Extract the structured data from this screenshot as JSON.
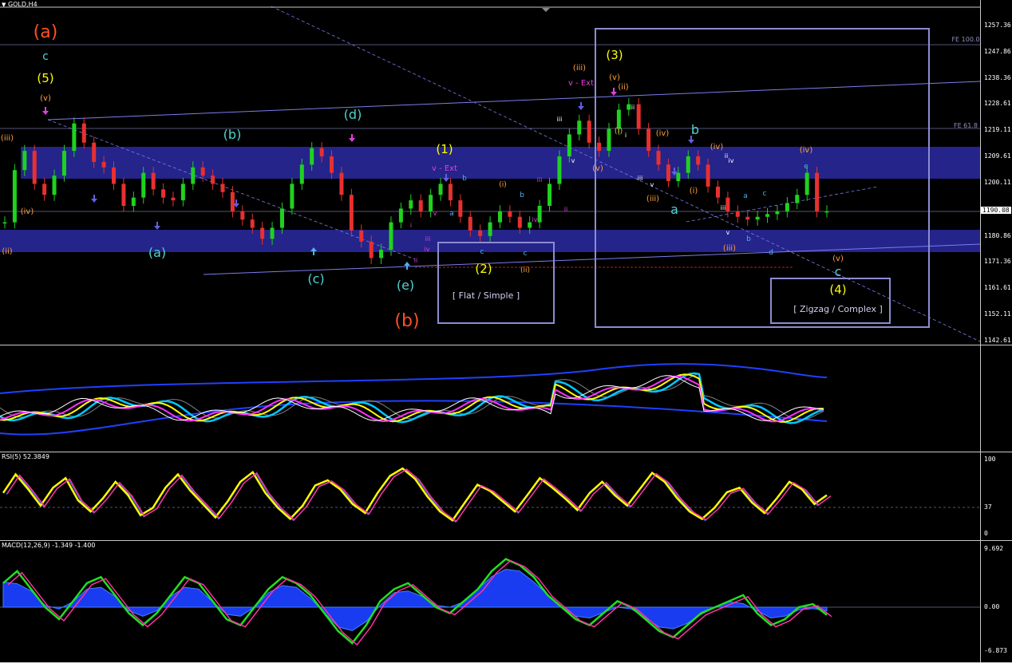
{
  "colors": {
    "bull": "#1fd21f",
    "bear": "#e83030",
    "band": "#24248a",
    "box": "#8c8cd2",
    "yellow": "#ffff00",
    "cyan": "#4fd2d2",
    "orange": "#ffa040",
    "magenta": "#e040e0"
  },
  "symbol": "GOLD,H4",
  "panes": {
    "main": {
      "ticks": [
        "1257.36",
        "1247.86",
        "1238.36",
        "1228.61",
        "1219.11",
        "1209.61",
        "1200.11",
        "1190.08",
        "1180.86",
        "1171.36",
        "1161.61",
        "1152.11",
        "1142.61"
      ],
      "current": "1190.08"
    },
    "rsi": {
      "title": "RSI(5) 52.3849",
      "ticks": [
        "100",
        "37",
        "0"
      ]
    },
    "macd": {
      "title": "MACD(12,26,9) -1.349 -1.400",
      "ticks": [
        "9.692",
        "0.00",
        "-6.873"
      ]
    }
  },
  "fib_levels": [
    "FE 100.0",
    "FE 61.8"
  ],
  "wave_labels": [
    "(a)",
    "c",
    "(5)",
    "(v)",
    "(iii)",
    "(iv)",
    "(ii)",
    "(b)",
    "(a)",
    "(c)",
    "(d)",
    "(e)",
    "(b)",
    "i",
    "ii",
    "iii",
    "iv",
    "v",
    "(1)",
    "v - Ext",
    "b",
    "a",
    "c",
    "b",
    "(i)",
    "(2)",
    "(ii)",
    "c",
    "iii",
    "iv",
    "ii",
    "(iii)",
    "v - Ext",
    "v",
    "iii",
    "(3)",
    "(v)",
    "(ii)",
    "(i)",
    "i",
    "ii",
    "(iv)",
    "iii",
    "(iii)",
    "(v)",
    "v",
    "b",
    "(iv)",
    "(i)",
    "ii",
    "a",
    "iv",
    "iii",
    "a",
    "c",
    "v",
    "b",
    "(iii)",
    "d",
    "e",
    "(iv)",
    "(v)",
    "c",
    "(4)"
  ],
  "boxes": {
    "flat": "[ Flat / Simple ]",
    "zigzag": "[ Zigzag / Complex ]"
  },
  "chart_data": [
    {
      "type": "line",
      "title": "GOLD,H4",
      "xlabel": "",
      "ylabel": "",
      "ylim": [
        1142.61,
        1260.0
      ],
      "grid": false,
      "series": [
        {
          "values": [
            1186,
            1205,
            1212,
            1200,
            1196,
            1203,
            1212,
            1222,
            1215,
            1208,
            1206,
            1200,
            1192,
            1195,
            1204,
            1198,
            1195,
            1194,
            1200,
            1206,
            1203,
            1200,
            1197,
            1190,
            1187,
            1184,
            1180,
            1184,
            1191,
            1200,
            1207,
            1213,
            1210,
            1204,
            1196,
            1183,
            1179,
            1173,
            1176,
            1186,
            1191,
            1194,
            1190,
            1196,
            1200,
            1194,
            1188,
            1183,
            1181,
            1186,
            1190,
            1188,
            1184,
            1186,
            1192,
            1200,
            1210,
            1218,
            1223,
            1215,
            1212,
            1220,
            1227,
            1229,
            1220,
            1212,
            1207,
            1201,
            1204,
            1210,
            1207,
            1199,
            1195,
            1190,
            1188,
            1187,
            1188,
            1189,
            1190,
            1193,
            1196,
            1204,
            1190,
            1190
          ]
        }
      ]
    },
    {
      "type": "line",
      "title": "RSI(5) 52.3849",
      "ylim": [
        0,
        100
      ],
      "series": [
        {
          "values": [
            55,
            80,
            60,
            38,
            62,
            75,
            45,
            30,
            48,
            70,
            52,
            25,
            35,
            62,
            80,
            58,
            40,
            22,
            44,
            70,
            83,
            55,
            35,
            20,
            38,
            65,
            72,
            60,
            40,
            28,
            55,
            78,
            88,
            74,
            50,
            30,
            18,
            42,
            66,
            58,
            44,
            30,
            52,
            75,
            62,
            48,
            32,
            55,
            70,
            52,
            38,
            60,
            82,
            70,
            48,
            30,
            20,
            35,
            56,
            62,
            42,
            28,
            48,
            70,
            60,
            40,
            52
          ]
        }
      ]
    },
    {
      "type": "line",
      "title": "MACD(12,26,9) -1.349 -1.400",
      "ylim": [
        -6.873,
        9.692
      ],
      "series": [
        {
          "values": [
            4,
            6,
            3,
            0,
            -2,
            1,
            4,
            5,
            2,
            -1,
            -3,
            -1,
            2,
            5,
            4,
            1,
            -2,
            -3,
            0,
            3,
            5,
            4,
            2,
            -1,
            -4,
            -6,
            -3,
            1,
            3,
            4,
            2,
            0,
            -1,
            1,
            3,
            6,
            8,
            7,
            5,
            2,
            0,
            -2,
            -3,
            -1,
            1,
            0,
            -2,
            -4,
            -5,
            -3,
            -1,
            0,
            1,
            2,
            -1,
            -3,
            -2,
            0,
            0.5,
            -1.3
          ]
        }
      ]
    }
  ]
}
